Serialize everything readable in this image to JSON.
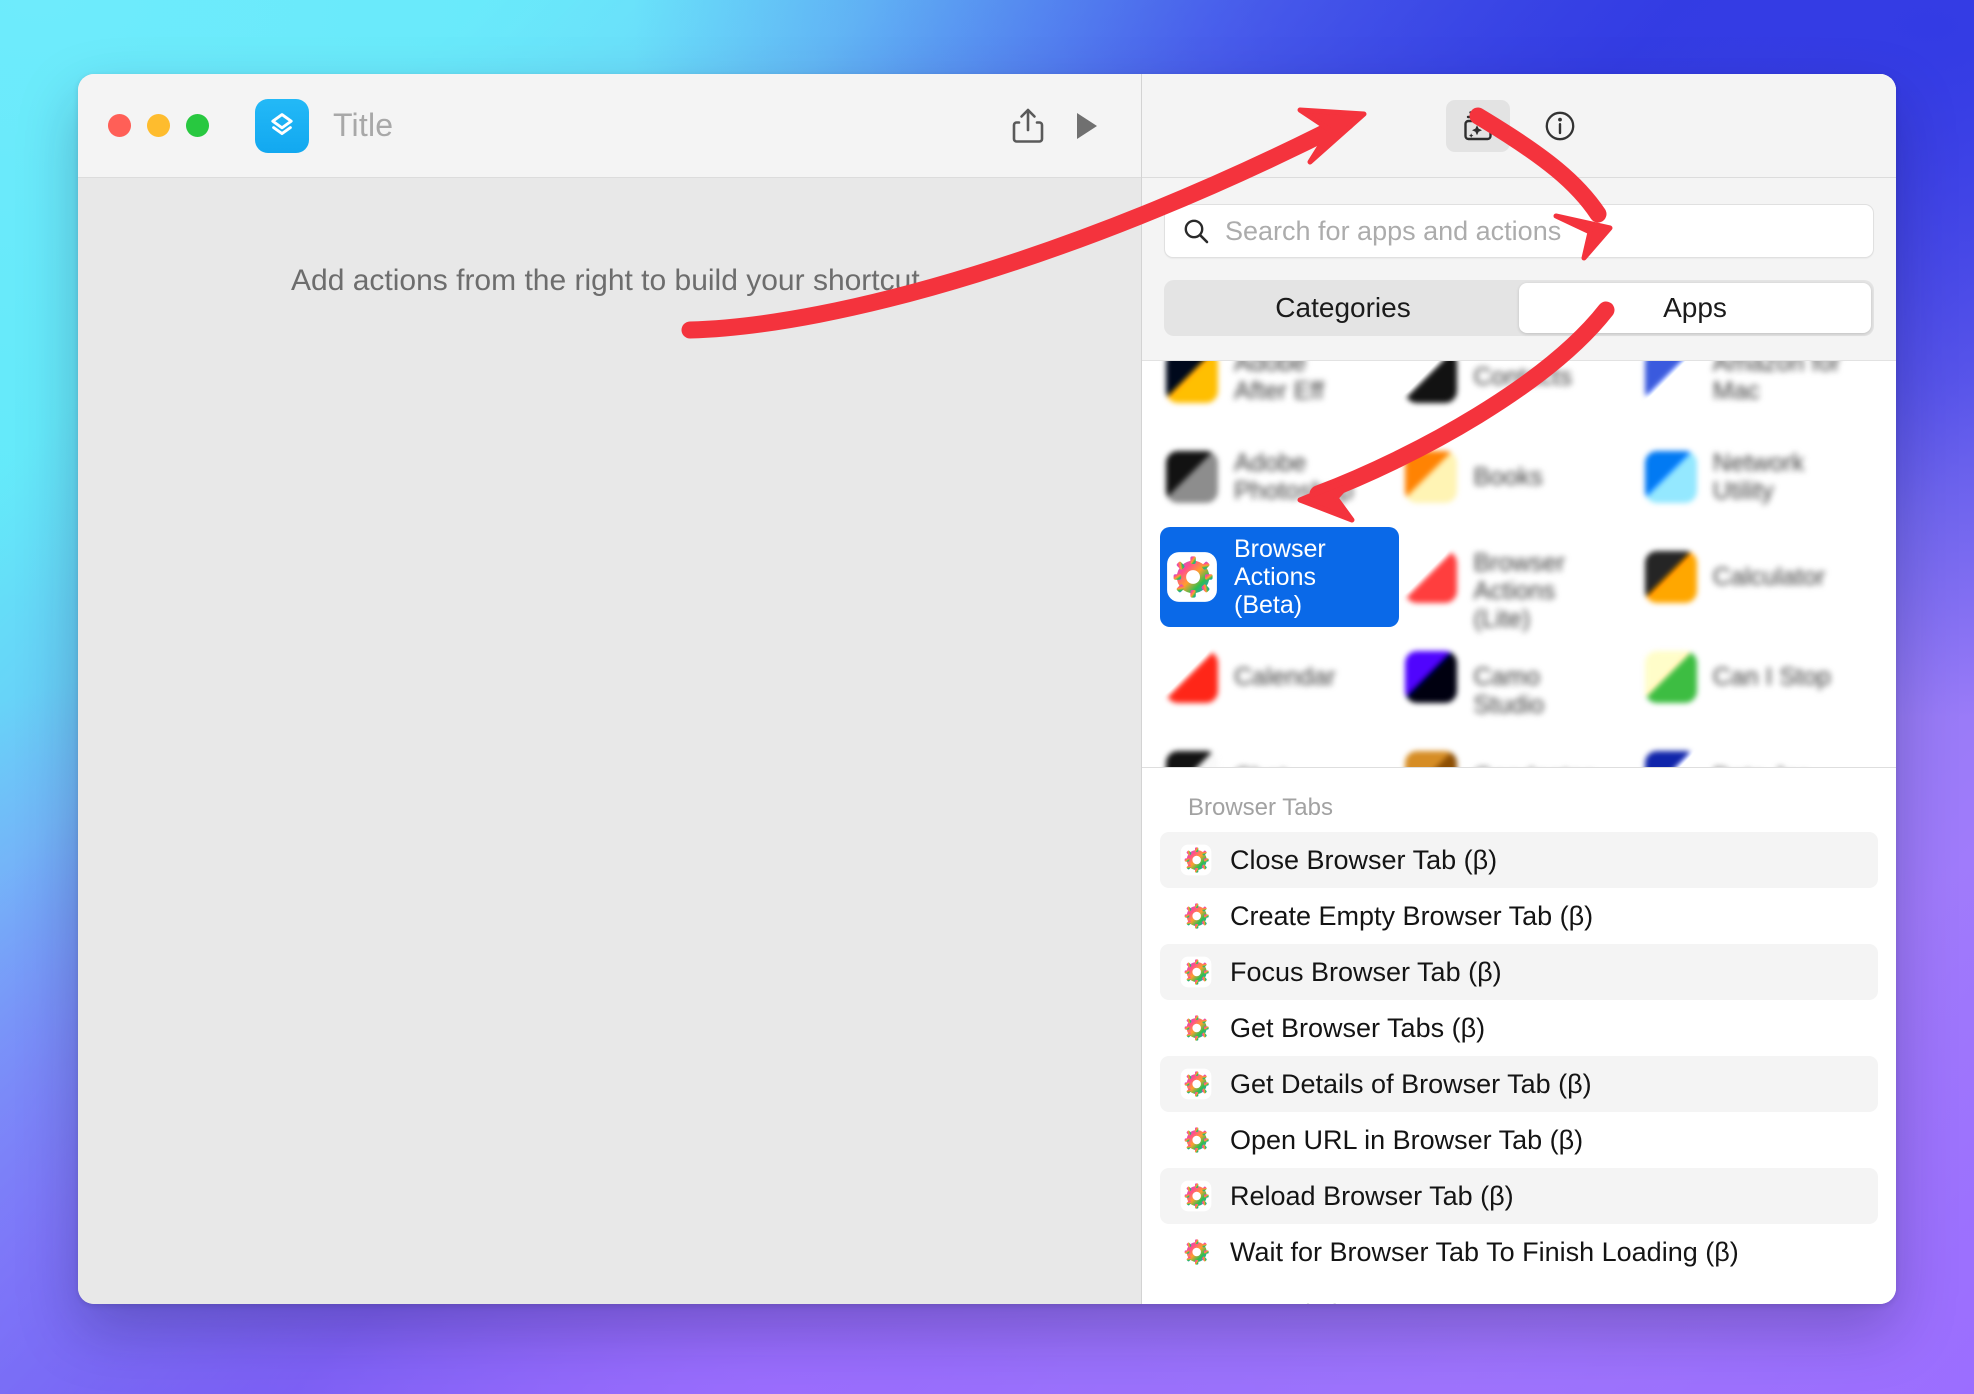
{
  "window": {
    "app_icon_name": "shortcuts-app-icon",
    "traffic_lights": [
      "close",
      "minimize",
      "zoom"
    ],
    "document_title": "Title",
    "toolbar": {
      "share_label": "Share",
      "run_label": "Run"
    }
  },
  "editor": {
    "empty_hint": "Add actions from the right to build your shortcut."
  },
  "library": {
    "header_buttons": [
      {
        "name": "action-library-button",
        "label": "Action Library",
        "active": true
      },
      {
        "name": "shortcut-details-button",
        "label": "Shortcut Details",
        "active": false
      }
    ],
    "search": {
      "placeholder": "Search for apps and actions",
      "value": ""
    },
    "segmented": {
      "options": [
        "Categories",
        "Apps"
      ],
      "selected": "Apps"
    },
    "apps": [
      {
        "label": "Adobe\nAfter Eff",
        "obscured": true,
        "selected": false,
        "icon_colors": [
          "#1b2433",
          "#f2b01e"
        ]
      },
      {
        "label": "Contacts",
        "obscured": true,
        "selected": false,
        "icon_colors": [
          "#ffffff",
          "#2b2b2b"
        ]
      },
      {
        "label": "Amazon for\nMac",
        "obscured": true,
        "selected": false,
        "icon_colors": [
          "#4a63c8",
          "#ffffff"
        ]
      },
      {
        "label": "Adobe\nPhotoshop",
        "obscured": true,
        "selected": false,
        "icon_colors": [
          "#2b2b2b",
          "#8a8a8a"
        ]
      },
      {
        "label": "Books",
        "obscured": true,
        "selected": false,
        "icon_colors": [
          "#f58220",
          "#ffd9a8"
        ]
      },
      {
        "label": "Network\nUtility",
        "obscured": true,
        "selected": false,
        "icon_colors": [
          "#1f7bd8",
          "#8fd0ff"
        ]
      },
      {
        "label": "Browser Actions (Beta)",
        "obscured": false,
        "selected": true,
        "icon_colors": [
          "#ffffff",
          "#ff3b30"
        ]
      },
      {
        "label": "Browser\nActions\n(Lite)",
        "obscured": true,
        "selected": false,
        "icon_colors": [
          "#ffffff",
          "#f14d4d"
        ]
      },
      {
        "label": "Calculator",
        "obscured": true,
        "selected": false,
        "icon_colors": [
          "#3a3a3a",
          "#f59e0b"
        ]
      },
      {
        "label": "Calendar",
        "obscured": true,
        "selected": false,
        "icon_colors": [
          "#ffffff",
          "#ff3b30"
        ]
      },
      {
        "label": "Camo\nStudio",
        "obscured": true,
        "selected": false,
        "icon_colors": [
          "#5b21e0",
          "#0a0a2a"
        ]
      },
      {
        "label": "Can I Stop",
        "obscured": true,
        "selected": false,
        "icon_colors": [
          "#f3e0b8",
          "#4caf50"
        ]
      },
      {
        "label": "Chat",
        "obscured": true,
        "selected": false,
        "icon_colors": [
          "#2b2b2b",
          "#dddddd"
        ]
      },
      {
        "label": "Goodnotes",
        "obscured": true,
        "selected": false,
        "icon_colors": [
          "#c28a3a",
          "#8a5a20"
        ]
      },
      {
        "label": "Data Jar",
        "obscured": true,
        "selected": false,
        "icon_colors": [
          "#2a3aa0",
          "#ffffff"
        ]
      }
    ],
    "action_sections": [
      {
        "title": "Browser Tabs",
        "actions": [
          "Close Browser Tab (β)",
          "Create Empty Browser Tab (β)",
          "Focus Browser Tab (β)",
          "Get Browser Tabs (β)",
          "Get Details of Browser Tab (β)",
          "Open URL in Browser Tab (β)",
          "Reload Browser Tab (β)",
          "Wait for Browser Tab To Finish Loading (β)"
        ]
      }
    ],
    "next_section_partial": "Browser Windows"
  },
  "annotations": {
    "color": "#f4333d",
    "arrows": [
      {
        "name": "arrow-to-action-library-button",
        "from": "editor canvas",
        "to": "action library button"
      },
      {
        "name": "arrow-to-search-field",
        "from": "action library button",
        "to": "search field"
      },
      {
        "name": "arrow-to-browser-actions-app",
        "from": "apps tab",
        "to": "Browser Actions (Beta)"
      }
    ]
  },
  "colors": {
    "accent_selection": "#0a69e8",
    "annotation_red": "#f4333d",
    "window_chrome": "#f4f4f4",
    "canvas": "#e8e8e8"
  }
}
